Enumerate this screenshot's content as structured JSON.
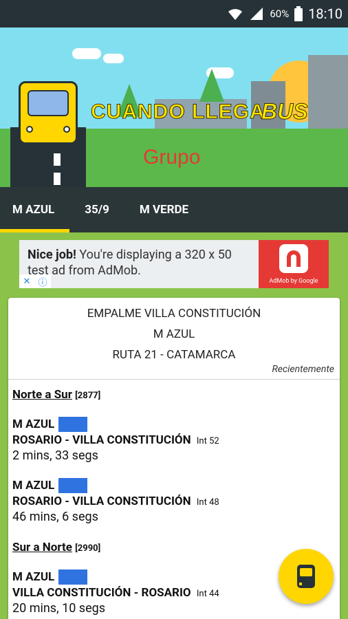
{
  "status_bar": {
    "battery_percent": "60%",
    "time": "18:10",
    "icons": [
      "wifi-icon",
      "signal-icon",
      "battery-icon"
    ]
  },
  "header": {
    "title_part1": "CUANDO LLEGA",
    "title_part2": "BUS",
    "group_label": "Grupo"
  },
  "tabs": [
    {
      "label": "M AZUL",
      "active": true
    },
    {
      "label": "35/9",
      "active": false
    },
    {
      "label": "M VERDE",
      "active": false
    }
  ],
  "ad": {
    "bold": "Nice job!",
    "text": " You're displaying a 320 x 50 test ad from AdMob.",
    "brand": "AdMob by Google"
  },
  "stop": {
    "name": "EMPALME VILLA CONSTITUCIÓN",
    "line": "M AZUL",
    "location": "RUTA 21  -  CATAMARCA",
    "recent_label": "Recientemente"
  },
  "directions": [
    {
      "label": "Norte a Sur",
      "code": "[2877]",
      "arrivals": [
        {
          "route": "M AZUL",
          "line": "ROSARIO - VILLA CONSTITUCIÓN",
          "internal": "Int 52",
          "eta": "2 mins, 33 segs"
        },
        {
          "route": "M AZUL",
          "line": "ROSARIO - VILLA CONSTITUCIÓN",
          "internal": "Int 48",
          "eta": "46 mins, 6 segs"
        }
      ]
    },
    {
      "label": "Sur a Norte",
      "code": "[2990]",
      "arrivals": [
        {
          "route": "M AZUL",
          "line": "VILLA CONSTITUCIÓN - ROSARIO",
          "internal": "Int 44",
          "eta": "20 mins, 10 segs"
        }
      ]
    }
  ],
  "colors": {
    "background": "#8bc34a",
    "tab_bar": "#2b3639",
    "tab_indicator": "#ffd600",
    "route_color": "#2f73e0",
    "fab": "#ffd600"
  }
}
